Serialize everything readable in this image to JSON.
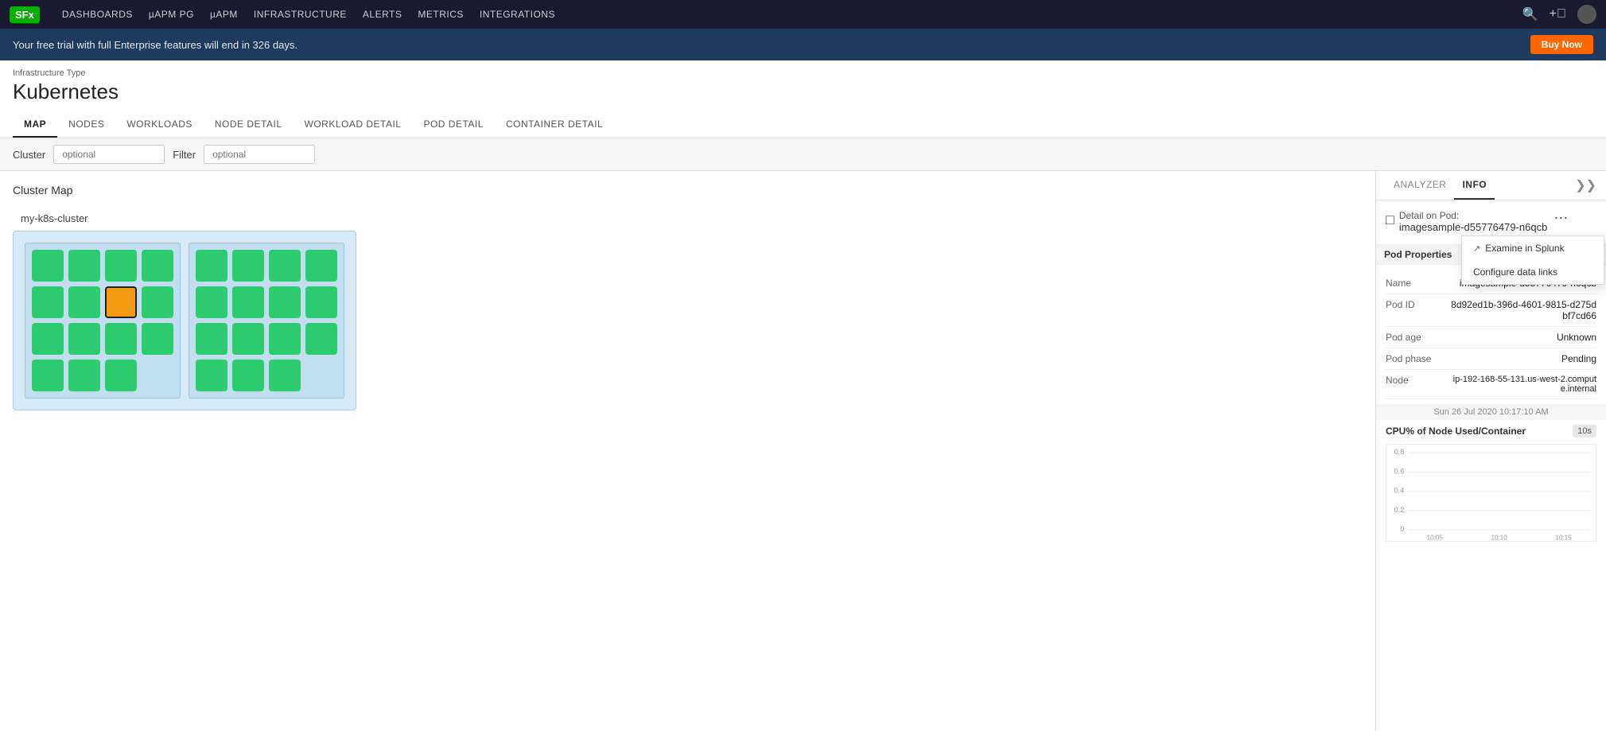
{
  "nav": {
    "logo": "SFx",
    "items": [
      "DASHBOARDS",
      "µAPM PG",
      "µAPM",
      "INFRASTRUCTURE",
      "ALERTS",
      "METRICS",
      "INTEGRATIONS"
    ]
  },
  "banner": {
    "message": "Your free trial with full Enterprise features will end in 326 days.",
    "cta": "Buy Now"
  },
  "page": {
    "infra_type": "Infrastructure Type",
    "title": "Kubernetes",
    "tabs": [
      "MAP",
      "NODES",
      "WORKLOADS",
      "NODE DETAIL",
      "WORKLOAD DETAIL",
      "POD DETAIL",
      "CONTAINER DETAIL"
    ],
    "active_tab": "MAP"
  },
  "filters": {
    "cluster_label": "Cluster",
    "cluster_placeholder": "optional",
    "filter_label": "Filter",
    "filter_placeholder": "optional"
  },
  "cluster_map": {
    "title": "Cluster Map",
    "cluster_name": "my-k8s-cluster"
  },
  "right_panel": {
    "tabs": [
      "ANALYZER",
      "INFO"
    ],
    "active_tab": "INFO",
    "pod_detail_label": "Detail on Pod:",
    "pod_name": "imagesample-d55776479-n6qcb",
    "dropdown": {
      "items": [
        "Examine in Splunk",
        "Configure data links"
      ]
    },
    "properties_title": "Pod Properties",
    "props": [
      {
        "key": "Name",
        "value": "imagesample-d55776479-n6qcb"
      },
      {
        "key": "Pod ID",
        "value": "8d92ed1b-396d-4601-9815-d275dbf7cd66"
      },
      {
        "key": "Pod age",
        "value": "Unknown"
      },
      {
        "key": "Pod phase",
        "value": "Pending"
      },
      {
        "key": "Node",
        "value": "ip-192-168-55-131.us-west-2.compute.internal"
      }
    ],
    "timestamp": "Sun 26 Jul 2020 10:17:10 AM",
    "chart": {
      "title": "CPU% of Node Used/Container",
      "interval": "10s",
      "y_labels": [
        "0.8",
        "0.6",
        "0.4",
        "0.2",
        "0"
      ],
      "x_labels": [
        "10:05",
        "10:10",
        "10:15"
      ]
    }
  }
}
